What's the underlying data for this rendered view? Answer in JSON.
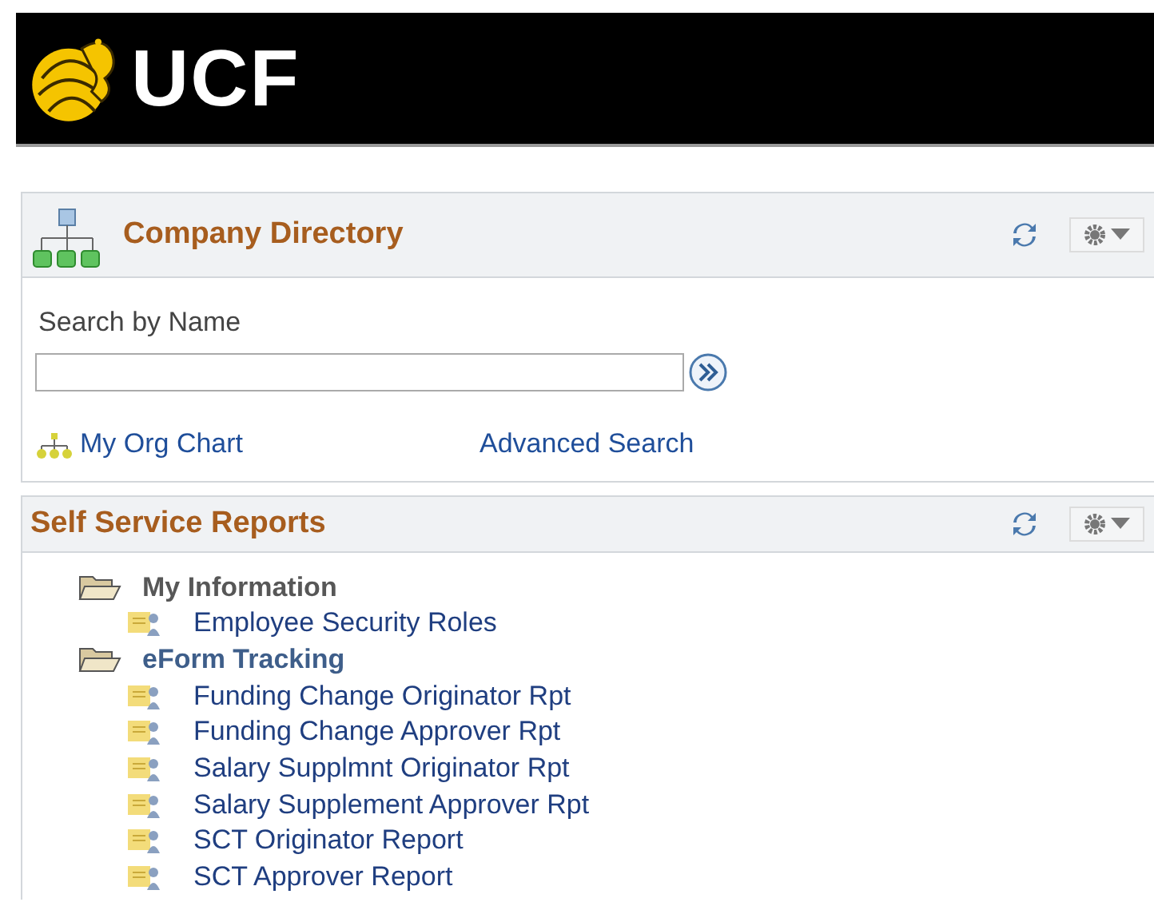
{
  "banner": {
    "logo_text": "UCF"
  },
  "panels": [
    {
      "title": "Company Directory",
      "kind": "directory",
      "search": {
        "label": "Search by Name"
      },
      "links": [
        {
          "label": "My Org Chart",
          "icon": true
        },
        {
          "label": "Advanced Search",
          "icon": false
        }
      ]
    },
    {
      "title": "Self Service Reports",
      "kind": "tree",
      "tree": [
        {
          "label": "My Information",
          "expanded": true,
          "children": [
            {
              "label": "Employee Security Roles"
            }
          ]
        },
        {
          "label": "eForm Tracking",
          "expanded": true,
          "children": [
            {
              "label": "Funding Change Originator Rpt"
            },
            {
              "label": "Funding Change Approver Rpt"
            },
            {
              "label": "Salary Supplmnt Originator Rpt"
            },
            {
              "label": "Salary Supplement Approver Rpt"
            },
            {
              "label": "SCT Originator Report"
            },
            {
              "label": "SCT Approver Report"
            }
          ]
        }
      ]
    }
  ]
}
